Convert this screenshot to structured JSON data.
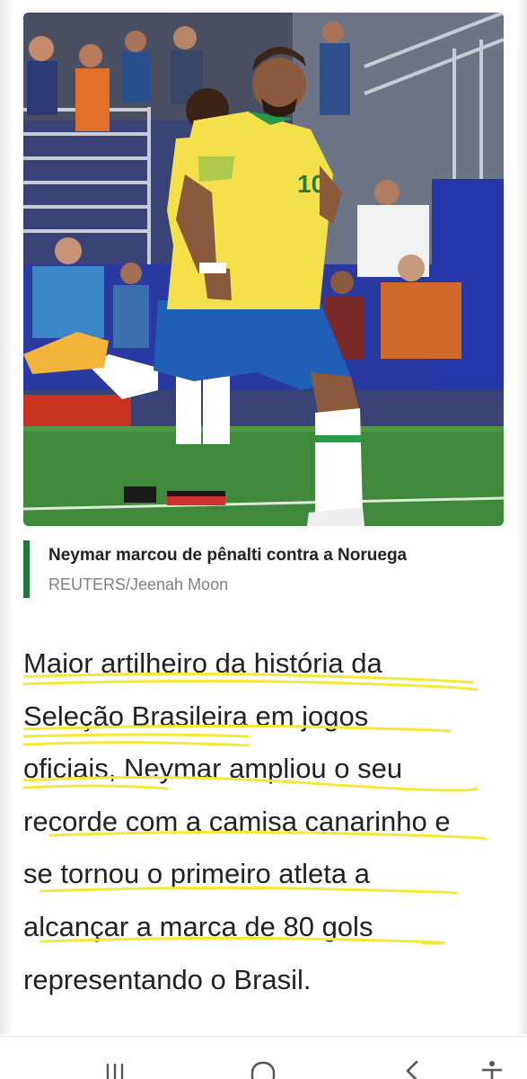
{
  "photo": {
    "jersey_number": "10",
    "colors": {
      "jersey_yellow": "#f3e04a",
      "shorts_blue": "#1f5fb8",
      "pitch_green": "#3f8a3a",
      "stand_blue": "#2a3a9a"
    }
  },
  "caption": {
    "title": "Neymar marcou de pênalti contra a Noruega",
    "credit": "REUTERS/Jeenah Moon",
    "accent_color": "#1f7a34"
  },
  "article": {
    "lines": [
      "Maior artilheiro da história da",
      "Seleção Brasileira em jogos",
      "oficiais, Neymar ampliou o seu",
      "recorde com a camisa canarinho e",
      "se tornou o primeiro atleta a",
      "alcançar a marca de 80 gols",
      "representando o Brasil."
    ],
    "highlight_color": "#f4ea3c"
  },
  "navbar": {
    "recent_apps": "recent-apps-icon",
    "home": "home-icon",
    "back": "back-icon",
    "accessibility": "accessibility-icon"
  }
}
